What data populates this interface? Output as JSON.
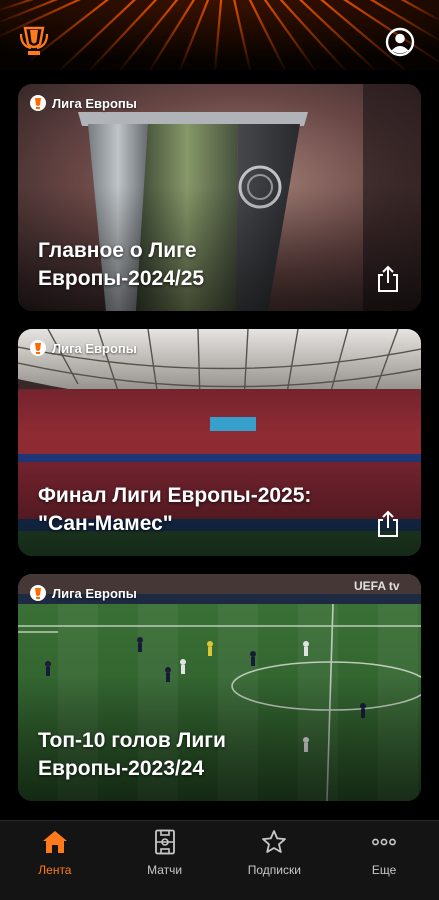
{
  "colors": {
    "accent": "#ff7a1a",
    "background": "#000000",
    "tabbar": "#141414"
  },
  "header": {
    "logo_icon": "europa-league-trophy-logo",
    "profile_icon": "user-profile-icon"
  },
  "cards": [
    {
      "badge": "Лига Европы",
      "title_line1": "Главное о Лиге",
      "title_line2": "Европы-2024/25",
      "share_icon": "share-icon"
    },
    {
      "badge": "Лига Европы",
      "title_line1": "Финал Лиги Европы-2025:",
      "title_line2": "\"Сан-Мамес\"",
      "share_icon": "share-icon"
    },
    {
      "badge": "Лига Европы",
      "title_line1": "Топ-10 голов Лиги",
      "title_line2": "Европы-2023/24"
    }
  ],
  "tabs": [
    {
      "label": "Лента",
      "icon": "home-icon",
      "active": true
    },
    {
      "label": "Матчи",
      "icon": "pitch-icon",
      "active": false
    },
    {
      "label": "Подписки",
      "icon": "star-icon",
      "active": false
    },
    {
      "label": "Еще",
      "icon": "more-dots-icon",
      "active": false
    }
  ]
}
